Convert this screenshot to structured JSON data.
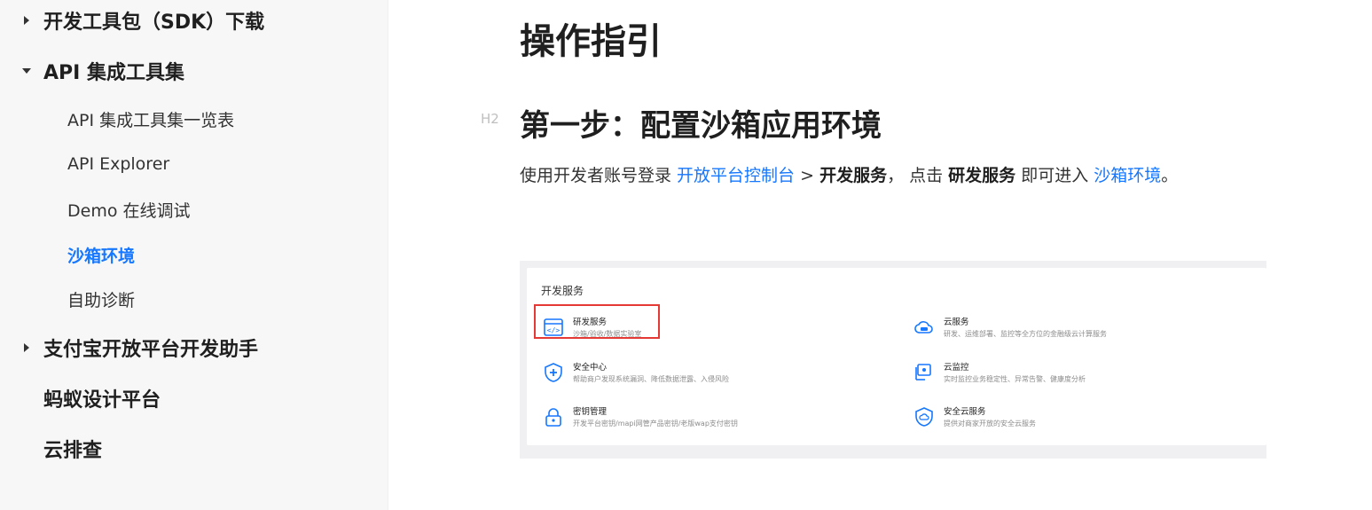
{
  "sidebar": {
    "groups": [
      {
        "label": "开发工具包（SDK）下载",
        "expanded": false
      },
      {
        "label": "API 集成工具集",
        "expanded": true
      },
      {
        "label": "支付宝开放平台开发助手",
        "expanded": false
      },
      {
        "label": "蚂蚁设计平台"
      },
      {
        "label": "云排查"
      }
    ],
    "items": [
      {
        "label": "API 集成工具集一览表"
      },
      {
        "label": "API Explorer"
      },
      {
        "label": "Demo 在线调试"
      },
      {
        "label": "沙箱环境",
        "active": true
      },
      {
        "label": "自助诊断"
      }
    ]
  },
  "main": {
    "title": "操作指引",
    "h2_marker": "H2",
    "step1_heading": "第一步：配置沙箱应用环境",
    "para": {
      "t1": "使用开发者账号登录 ",
      "link1": "开放平台控制台",
      "t2": " > ",
      "b1": "开发服务",
      "t3": "， 点击 ",
      "b2": "研发服务",
      "t4": " 即可进入 ",
      "link2": "沙箱环境",
      "t5": "。"
    },
    "screenshot": {
      "title": "开发服务",
      "services": [
        {
          "name": "研发服务",
          "desc": "沙箱/验收/数据实验室",
          "icon": "code-window-icon"
        },
        {
          "name": "云服务",
          "desc": "研发、运维部署、监控等全方位的金融级云计算服务",
          "icon": "cloud-icon"
        },
        {
          "name": "安全中心",
          "desc": "帮助商户发现系统漏洞、降低数据泄露、入侵风险",
          "icon": "shield-plus-icon"
        },
        {
          "name": "云监控",
          "desc": "实时监控业务稳定性、异常告警、健康度分析",
          "icon": "monitor-camera-icon"
        },
        {
          "name": "密钥管理",
          "desc": "开发平台密钥/mapi网管产品密钥/老版wap支付密钥",
          "icon": "lock-icon"
        },
        {
          "name": "安全云服务",
          "desc": "提供对商家开放的安全云服务",
          "icon": "shield-cloud-icon"
        }
      ]
    }
  },
  "colors": {
    "accent": "#1677ff",
    "highlight": "#e53935",
    "sidebar_bg": "#f7f7f7"
  }
}
